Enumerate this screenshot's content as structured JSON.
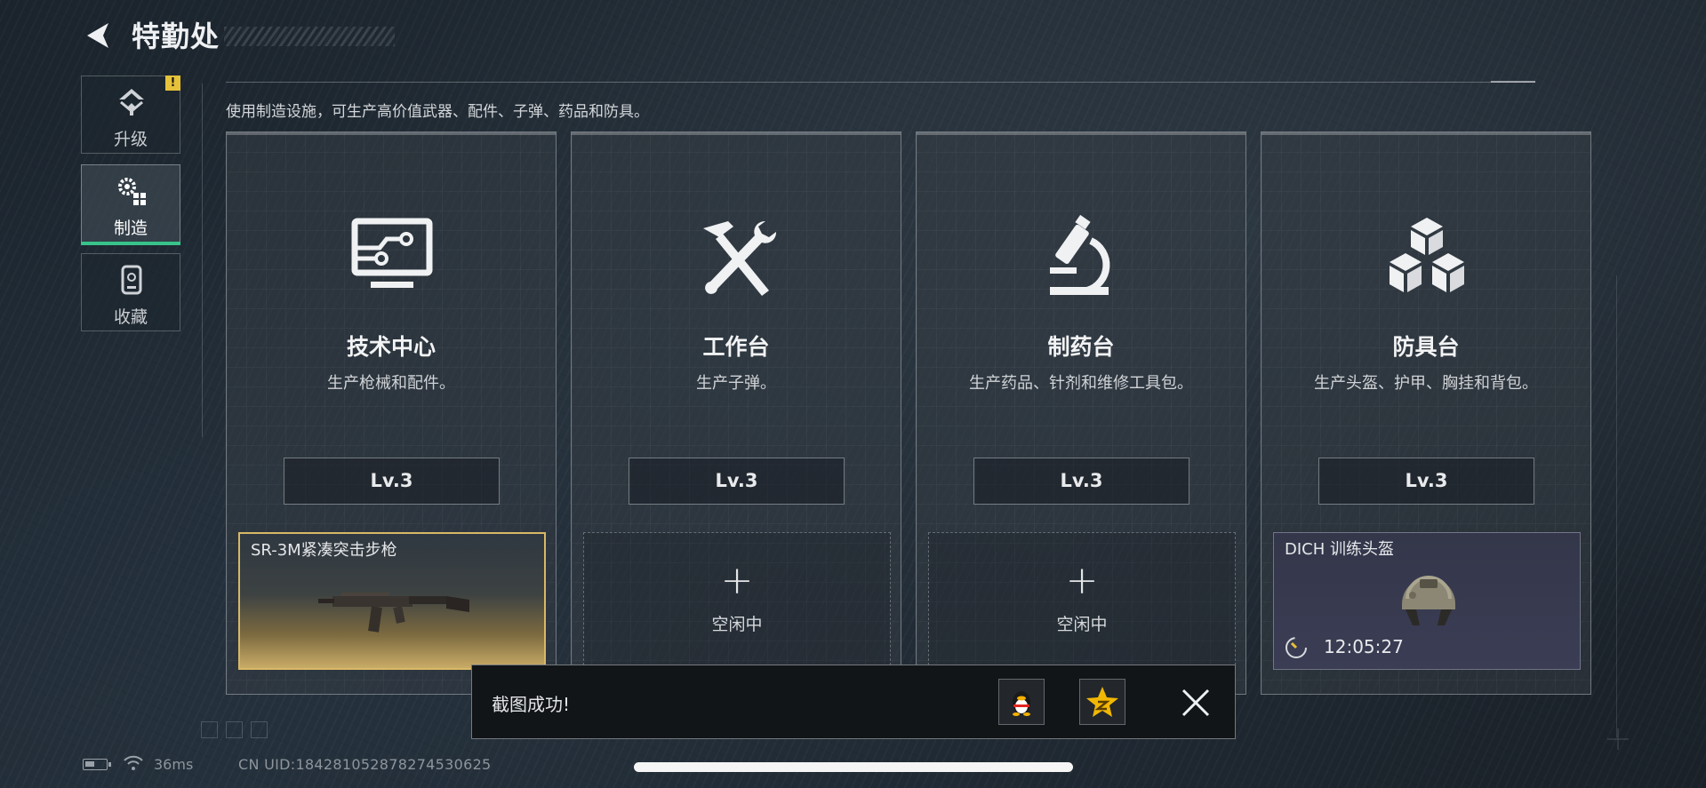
{
  "header": {
    "title": "特勤处",
    "subtitle": "使用制造设施，可生产高价值武器、配件、子弹、药品和防具。"
  },
  "sidebar": {
    "items": [
      {
        "label": "升级",
        "icon": "upgrade-icon",
        "badge": "!"
      },
      {
        "label": "制造",
        "icon": "gears-icon",
        "active": true
      },
      {
        "label": "收藏",
        "icon": "collection-icon"
      }
    ],
    "accent": "#37c38a"
  },
  "stations": [
    {
      "name": "技术中心",
      "desc": "生产枪械和配件。",
      "level": "Lv.3",
      "icon": "monitor-circuit-icon",
      "slot": {
        "state": "producing",
        "item": "SR-3M紧凑突击步枪",
        "item_icon": "rifle-icon"
      }
    },
    {
      "name": "工作台",
      "desc": "生产子弹。",
      "level": "Lv.3",
      "icon": "hammer-wrench-icon",
      "slot": {
        "state": "idle",
        "label": "空闲中"
      }
    },
    {
      "name": "制药台",
      "desc": "生产药品、针剂和维修工具包。",
      "level": "Lv.3",
      "icon": "microscope-icon",
      "slot": {
        "state": "idle",
        "label": "空闲中"
      }
    },
    {
      "name": "防具台",
      "desc": "生产头盔、护甲、胸挂和背包。",
      "level": "Lv.3",
      "icon": "boxes-icon",
      "slot": {
        "state": "producing",
        "item": "DICH 训练头盔",
        "item_icon": "helmet-icon",
        "timer": "12:05:27"
      }
    }
  ],
  "toast": {
    "message": "截图成功!",
    "share_targets": [
      "qq-penguin-icon",
      "qzone-star-icon"
    ]
  },
  "status_bar": {
    "ping": "36ms",
    "uid": "CN UID:18428105287827453062​5"
  },
  "colors": {
    "gold_slot": "#d8b866",
    "badge": "#e6c13a"
  }
}
